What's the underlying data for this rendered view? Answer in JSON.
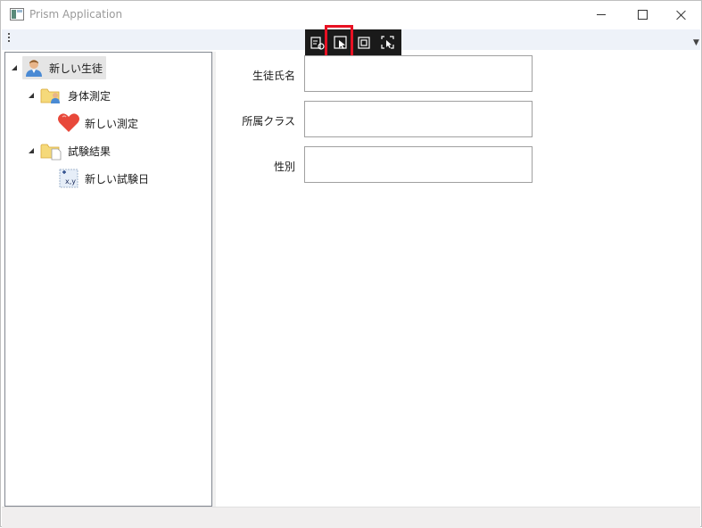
{
  "window": {
    "title": "Prism Application"
  },
  "tree": {
    "root": {
      "label": "新しい生徒",
      "icon": "student-icon"
    },
    "groups": [
      {
        "label": "身体測定",
        "icon": "folder-person-icon",
        "child": {
          "label": "新しい測定",
          "icon": "heart-icon"
        }
      },
      {
        "label": "試験結果",
        "icon": "folder-document-icon",
        "child": {
          "label": "新しい試験日",
          "icon": "xy-chart-icon"
        }
      }
    ]
  },
  "form": {
    "fields": [
      {
        "label": "生徒氏名",
        "value": ""
      },
      {
        "label": "所属クラス",
        "value": ""
      },
      {
        "label": "性別",
        "value": ""
      }
    ]
  },
  "colors": {
    "selection_highlight": "#e81123",
    "overlay_bg": "#1a1a1a",
    "toolbar_bg": "#eef2f9"
  }
}
